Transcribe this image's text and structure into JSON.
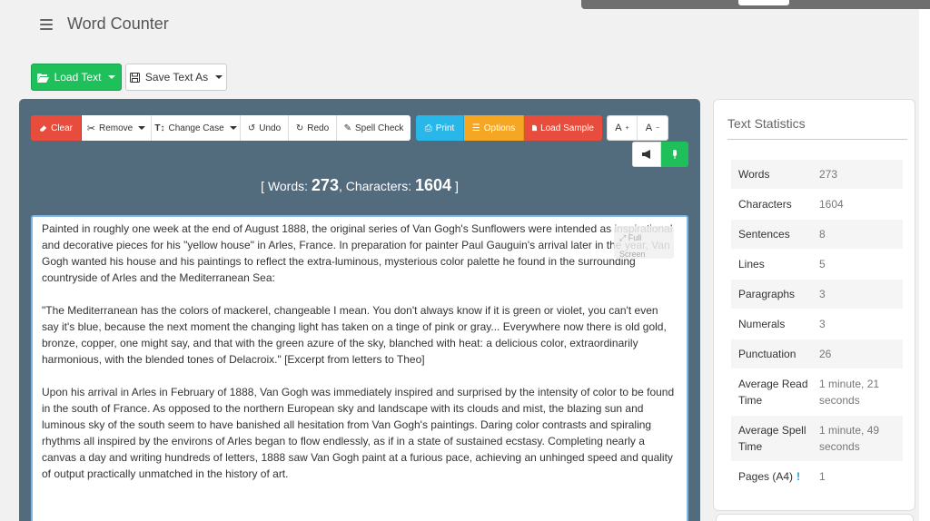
{
  "app": {
    "title": "Word Counter"
  },
  "actions": {
    "load_text": "Load Text",
    "save_text": "Save Text As"
  },
  "toolbar": {
    "clear": "Clear",
    "remove": "Remove",
    "change_case": "Change Case",
    "undo": "Undo",
    "redo": "Redo",
    "spell_check": "Spell Check",
    "print": "Print",
    "options": "Options",
    "load_sample": "Load Sample",
    "font_increase": "A",
    "font_decrease": "A"
  },
  "counter": {
    "words_label": "Words:",
    "words": "273",
    "chars_label": "Characters:",
    "chars": "1604",
    "open": "[",
    "close": "]"
  },
  "editor": {
    "paragraphs": [
      "Painted in roughly one week at the end of August 1888, the original series of Van Gogh's Sunflowers were intended as inspirational and decorative pieces for his \"yellow house\" in Arles, France. In preparation for painter Paul Gauguin's arrival later in the year, Van Gogh wanted his house and his paintings to reflect the extra-luminous, mysterious color palette he found in the surrounding countryside of Arles and the Mediterranean Sea:",
      "\"The Mediterranean has the colors of mackerel, changeable I mean. You don't always know if it is green or violet, you can't even say it's blue, because the next moment the changing light has taken on a tinge of pink or gray... Everywhere now there is old gold, bronze, copper, one might say, and that with the green azure of the sky, blanched with heat: a delicious color, extraordinarily harmonious, with the blended tones of Delacroix.\" [Excerpt from letters to Theo]",
      "Upon his arrival in Arles in February of 1888, Van Gogh was immediately inspired and surprised by the intensity of color to be found in the south of France. As opposed to the northern European sky and landscape with its clouds and mist, the blazing sun and luminous sky of the south seem to have banished all hesitation from Van Gogh's paintings. Daring color contrasts and spiraling rhythms all inspired by the environs of Arles began to flow endlessly, as if in a state of sustained ecstasy. Completing nearly a canvas a day and writing hundreds of letters, 1888 saw Van Gogh paint at a furious pace, achieving an unhinged speed and quality of output practically unmatched in the history of art."
    ],
    "fullscreen": "Full Screen"
  },
  "stats": {
    "title": "Text Statistics",
    "rows": [
      {
        "label": "Words",
        "value": "273"
      },
      {
        "label": "Characters",
        "value": "1604"
      },
      {
        "label": "Sentences",
        "value": "8"
      },
      {
        "label": "Lines",
        "value": "5"
      },
      {
        "label": "Paragraphs",
        "value": "3"
      },
      {
        "label": "Numerals",
        "value": "3"
      },
      {
        "label": "Punctuation",
        "value": "26"
      },
      {
        "label": "Average Read Time",
        "value": "1 minute, 21 seconds"
      },
      {
        "label": "Average Spell Time",
        "value": "1 minute, 49 seconds"
      },
      {
        "label": "Pages (A4)",
        "value": "1"
      }
    ],
    "pages_note": "!"
  },
  "colors": {
    "panel": "#526b7d",
    "green": "#1fbf5b",
    "red": "#e74c3c",
    "blue": "#29b6e8",
    "orange": "#f5a623"
  }
}
